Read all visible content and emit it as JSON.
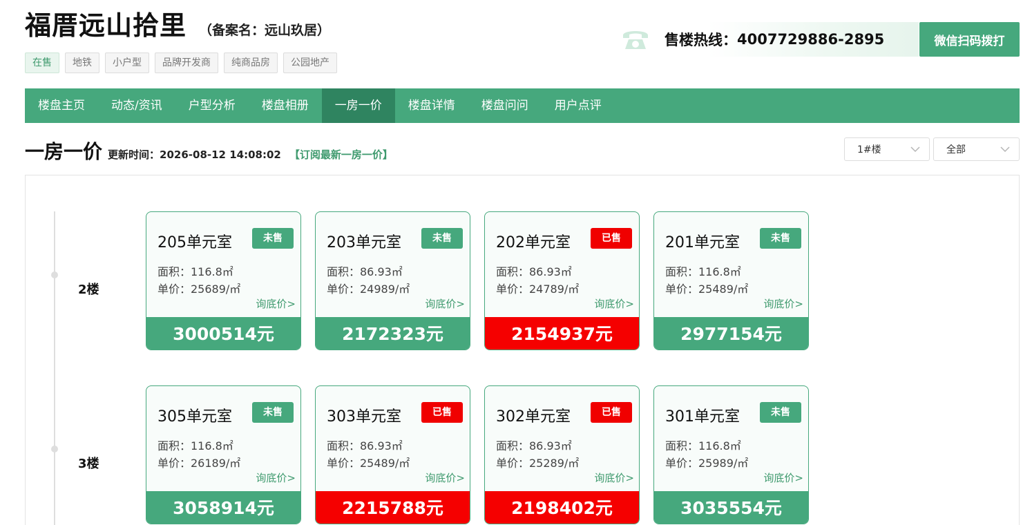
{
  "header": {
    "title": "福厝远山拾里",
    "alias": "（备案名：远山玖居）",
    "tags": [
      {
        "label": "在售",
        "active": true
      },
      {
        "label": "地铁",
        "active": false
      },
      {
        "label": "小户型",
        "active": false
      },
      {
        "label": "品牌开发商",
        "active": false
      },
      {
        "label": "纯商品房",
        "active": false
      },
      {
        "label": "公园地产",
        "active": false
      }
    ],
    "hotline_label": "售楼热线：",
    "hotline_number": "4007729886-2895",
    "scan_button": "微信扫码拨打"
  },
  "nav": {
    "items": [
      "楼盘主页",
      "动态/资讯",
      "户型分析",
      "楼盘相册",
      "一房一价",
      "楼盘详情",
      "楼盘问问",
      "用户点评"
    ],
    "active_index": 4
  },
  "section": {
    "title": "一房一价",
    "update_label": "更新时间：",
    "update_time": "2026-08-12 14:08:02",
    "subscribe": "【订阅最新一房一价】"
  },
  "filters": {
    "building": "1#楼",
    "status": "全部"
  },
  "floors": [
    {
      "label": "2楼",
      "units": [
        {
          "room": "205单元室",
          "status": "未售",
          "sold": false,
          "area": "面积：116.8㎡",
          "unit_price": "单价：25689/㎡",
          "ask": "询底价>",
          "total": "3000514元"
        },
        {
          "room": "203单元室",
          "status": "未售",
          "sold": false,
          "area": "面积：86.93㎡",
          "unit_price": "单价：24989/㎡",
          "ask": "询底价>",
          "total": "2172323元"
        },
        {
          "room": "202单元室",
          "status": "已售",
          "sold": true,
          "area": "面积：86.93㎡",
          "unit_price": "单价：24789/㎡",
          "ask": "询底价>",
          "total": "2154937元"
        },
        {
          "room": "201单元室",
          "status": "未售",
          "sold": false,
          "area": "面积：116.8㎡",
          "unit_price": "单价：25489/㎡",
          "ask": "询底价>",
          "total": "2977154元"
        }
      ]
    },
    {
      "label": "3楼",
      "units": [
        {
          "room": "305单元室",
          "status": "未售",
          "sold": false,
          "area": "面积：116.8㎡",
          "unit_price": "单价：26189/㎡",
          "ask": "询底价>",
          "total": "3058914元"
        },
        {
          "room": "303单元室",
          "status": "已售",
          "sold": true,
          "area": "面积：86.93㎡",
          "unit_price": "单价：25489/㎡",
          "ask": "询底价>",
          "total": "2215788元"
        },
        {
          "room": "302单元室",
          "status": "已售",
          "sold": true,
          "area": "面积：86.93㎡",
          "unit_price": "单价：25289/㎡",
          "ask": "询底价>",
          "total": "2198402元"
        },
        {
          "room": "301单元室",
          "status": "未售",
          "sold": false,
          "area": "面积：116.8㎡",
          "unit_price": "单价：25989/㎡",
          "ask": "询底价>",
          "total": "3035554元"
        }
      ]
    }
  ],
  "colors": {
    "brand_green": "#46a87d",
    "nav_active": "#2f8460",
    "sold_red": "#f50000"
  },
  "icons": {
    "phone": "phone-icon",
    "dropdown": "chevron-down-icon"
  }
}
